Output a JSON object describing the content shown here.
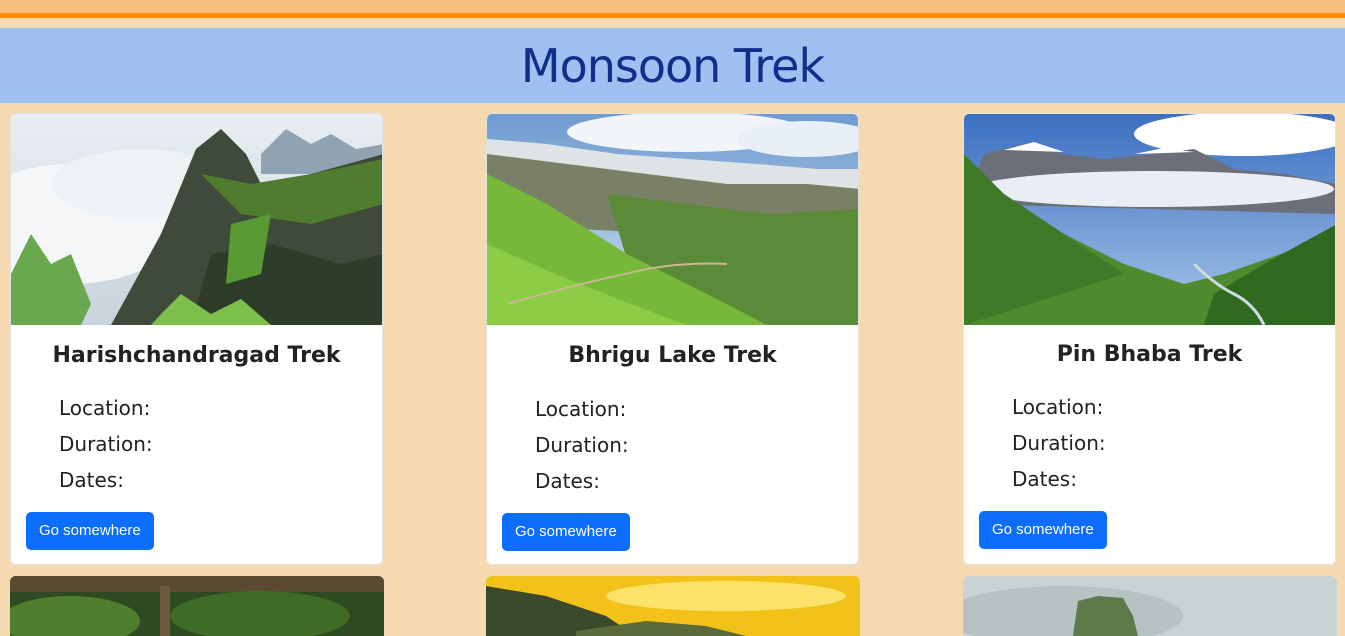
{
  "header": {
    "title": "Monsoon Trek"
  },
  "cards": [
    {
      "title": "Harishchandragad Trek",
      "location_label": "Location:",
      "duration_label": "Duration:",
      "dates_label": "Dates:",
      "button_label": "Go somewhere"
    },
    {
      "title": "Bhrigu Lake Trek",
      "location_label": "Location:",
      "duration_label": "Duration:",
      "dates_label": "Dates:",
      "button_label": "Go somewhere"
    },
    {
      "title": "Pin Bhaba Trek",
      "location_label": "Location:",
      "duration_label": "Duration:",
      "dates_label": "Dates:",
      "button_label": "Go somewhere"
    }
  ],
  "colors": {
    "page_bg": "#f5d9b1",
    "top_stripe": "#ff8c00",
    "header_bg": "#9fc0f1",
    "title_color": "#0f2f8a",
    "button_bg": "#0d6efd"
  }
}
